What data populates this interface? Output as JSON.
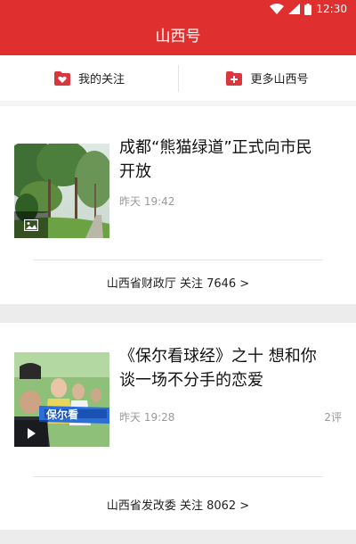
{
  "status_bar": {
    "time": "12:30",
    "icons": [
      "wifi-icon",
      "signal-icon",
      "battery-icon"
    ]
  },
  "header": {
    "title": "山西号"
  },
  "subnav": {
    "follow_label": "我的关注",
    "follow_icon": "heart-folder-icon",
    "more_label": "更多山西号",
    "more_icon": "add-folder-icon"
  },
  "articles": [
    {
      "title_line1": "成都“熊猫绿道”正式向市民",
      "title_line2": "开放",
      "time": "昨天 19:42",
      "comments": "",
      "media_badge": "image-icon",
      "source": "山西省财政厅 关注 7646 >"
    },
    {
      "title_line1": "《保尔看球经》之十  想和你",
      "title_line2": "谈一场不分手的恋爱",
      "time": "昨天 19:28",
      "comments": "2评",
      "media_badge": "play-icon",
      "source": "山西省发改委 关注 8062 >"
    }
  ],
  "colors": {
    "brand_red": "#e02f2f",
    "meta_gray": "#9a9a9a"
  }
}
